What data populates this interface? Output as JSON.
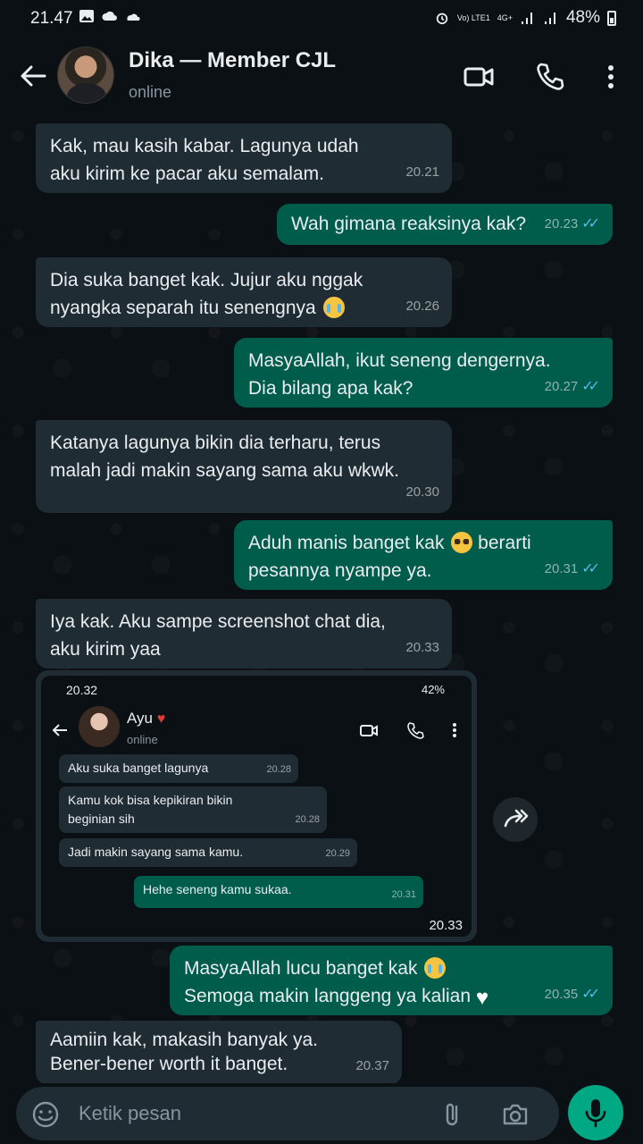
{
  "status_bar": {
    "time": "21.47",
    "network": "Vo) LTE1",
    "net_type": "4G+",
    "battery": "48%"
  },
  "header": {
    "name": "Dika — Member CJL",
    "status": "online"
  },
  "messages": [
    {
      "text1": "Kak, mau kasih kabar. Lagunya udah",
      "text2": "aku kirim ke pacar aku semalam.",
      "time": "20.21"
    },
    {
      "text1": "Wah gimana reaksinya kak?",
      "time": "20.23"
    },
    {
      "text1": "Dia suka banget kak. Jujur aku nggak",
      "text2": "nyangka separah itu senengnya",
      "time": "20.26"
    },
    {
      "text1": "MasyaAllah, ikut seneng dengernya.",
      "text2": "Dia bilang apa kak?",
      "time": "20.27"
    },
    {
      "text1": "Katanya lagunya bikin dia terharu, terus",
      "text2": "malah jadi makin sayang sama aku wkwk.",
      "time": "20.30"
    },
    {
      "text1": "Aduh manis banget kak",
      "text1b": "berarti",
      "text2": "pesannya nyampe ya.",
      "time": "20.31"
    },
    {
      "text1": "Iya kak. Aku sampe screenshot chat dia,",
      "text2": "aku kirim yaa",
      "time": "20.33"
    },
    {
      "text1": "MasyaAllah lucu banget kak",
      "text2": "Semoga makin langgeng ya kalian",
      "time": "20.35"
    },
    {
      "text1": "Aamiin kak, makasih banyak ya.",
      "text2": "Bener-bener worth it banget.",
      "time": "20.37"
    }
  ],
  "screenshot": {
    "time": "20.32",
    "battery": "42%",
    "name": "Ayu",
    "status": "online",
    "sent_time": "20.33",
    "messages": [
      {
        "text": "Aku suka banget lagunya",
        "time": "20.28"
      },
      {
        "text1": "Kamu kok bisa kepikiran bikin",
        "text2": "beginian sih",
        "time": "20.28"
      },
      {
        "text": "Jadi makin sayang sama kamu.",
        "time": "20.29"
      },
      {
        "text": "Hehe seneng kamu sukaa.",
        "time": "20.31"
      }
    ]
  },
  "input": {
    "placeholder": "Ketik pesan"
  }
}
